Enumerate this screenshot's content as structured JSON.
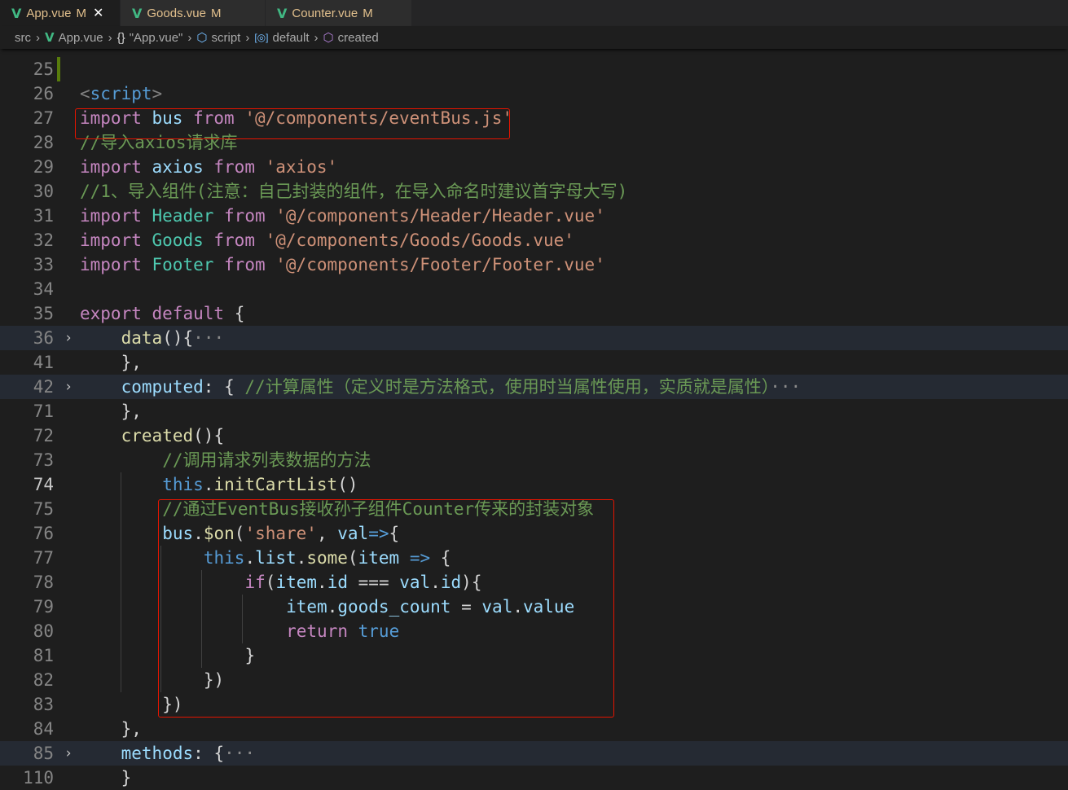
{
  "tabs": [
    {
      "label": "App.vue",
      "status": "M",
      "active": true
    },
    {
      "label": "Goods.vue",
      "status": "M",
      "active": false
    },
    {
      "label": "Counter.vue",
      "status": "M",
      "active": false
    }
  ],
  "breadcrumb": {
    "src": "src",
    "file": "App.vue",
    "object": "\"App.vue\"",
    "script": "script",
    "default": "default",
    "created": "created"
  },
  "editor": {
    "current_line": "74",
    "lines": [
      {
        "num": "25",
        "text": ""
      },
      {
        "num": "26",
        "text": "<script>"
      },
      {
        "num": "27",
        "text": "import bus from '@/components/eventBus.js'"
      },
      {
        "num": "28",
        "text": "//导入axios请求库"
      },
      {
        "num": "29",
        "text": "import axios from 'axios'"
      },
      {
        "num": "30",
        "text": "//1、导入组件(注意：自己封装的组件，在导入命名时建议首字母大写)"
      },
      {
        "num": "31",
        "text": "import Header from '@/components/Header/Header.vue'"
      },
      {
        "num": "32",
        "text": "import Goods from '@/components/Goods/Goods.vue'"
      },
      {
        "num": "33",
        "text": "import Footer from '@/components/Footer/Footer.vue'"
      },
      {
        "num": "34",
        "text": ""
      },
      {
        "num": "35",
        "text": "export default {"
      },
      {
        "num": "36",
        "text": "    data(){···"
      },
      {
        "num": "41",
        "text": "    },"
      },
      {
        "num": "42",
        "text": "    computed: { //计算属性（定义时是方法格式，使用时当属性使用，实质就是属性）···"
      },
      {
        "num": "71",
        "text": "    },"
      },
      {
        "num": "72",
        "text": "    created(){"
      },
      {
        "num": "73",
        "text": "        //调用请求列表数据的方法"
      },
      {
        "num": "74",
        "text": "        this.initCartList()"
      },
      {
        "num": "75",
        "text": "        //通过EventBus接收孙子组件Counter传来的封装对象"
      },
      {
        "num": "76",
        "text": "        bus.$on('share', val=>{"
      },
      {
        "num": "77",
        "text": "            this.list.some(item => {"
      },
      {
        "num": "78",
        "text": "                if(item.id === val.id){"
      },
      {
        "num": "79",
        "text": "                    item.goods_count = val.value"
      },
      {
        "num": "80",
        "text": "                    return true"
      },
      {
        "num": "81",
        "text": "                }"
      },
      {
        "num": "82",
        "text": "            })"
      },
      {
        "num": "83",
        "text": "        })"
      },
      {
        "num": "84",
        "text": "    },"
      },
      {
        "num": "85",
        "text": "    methods: {···"
      },
      {
        "num": "110",
        "text": "    }"
      }
    ]
  },
  "colors": {
    "background": "#1e1e1e",
    "keyword": "#c586c0",
    "string": "#ce9178",
    "comment": "#6a9955",
    "variable": "#9cdcfe",
    "function": "#dcdcaa",
    "highlight_box": "#e51400"
  }
}
